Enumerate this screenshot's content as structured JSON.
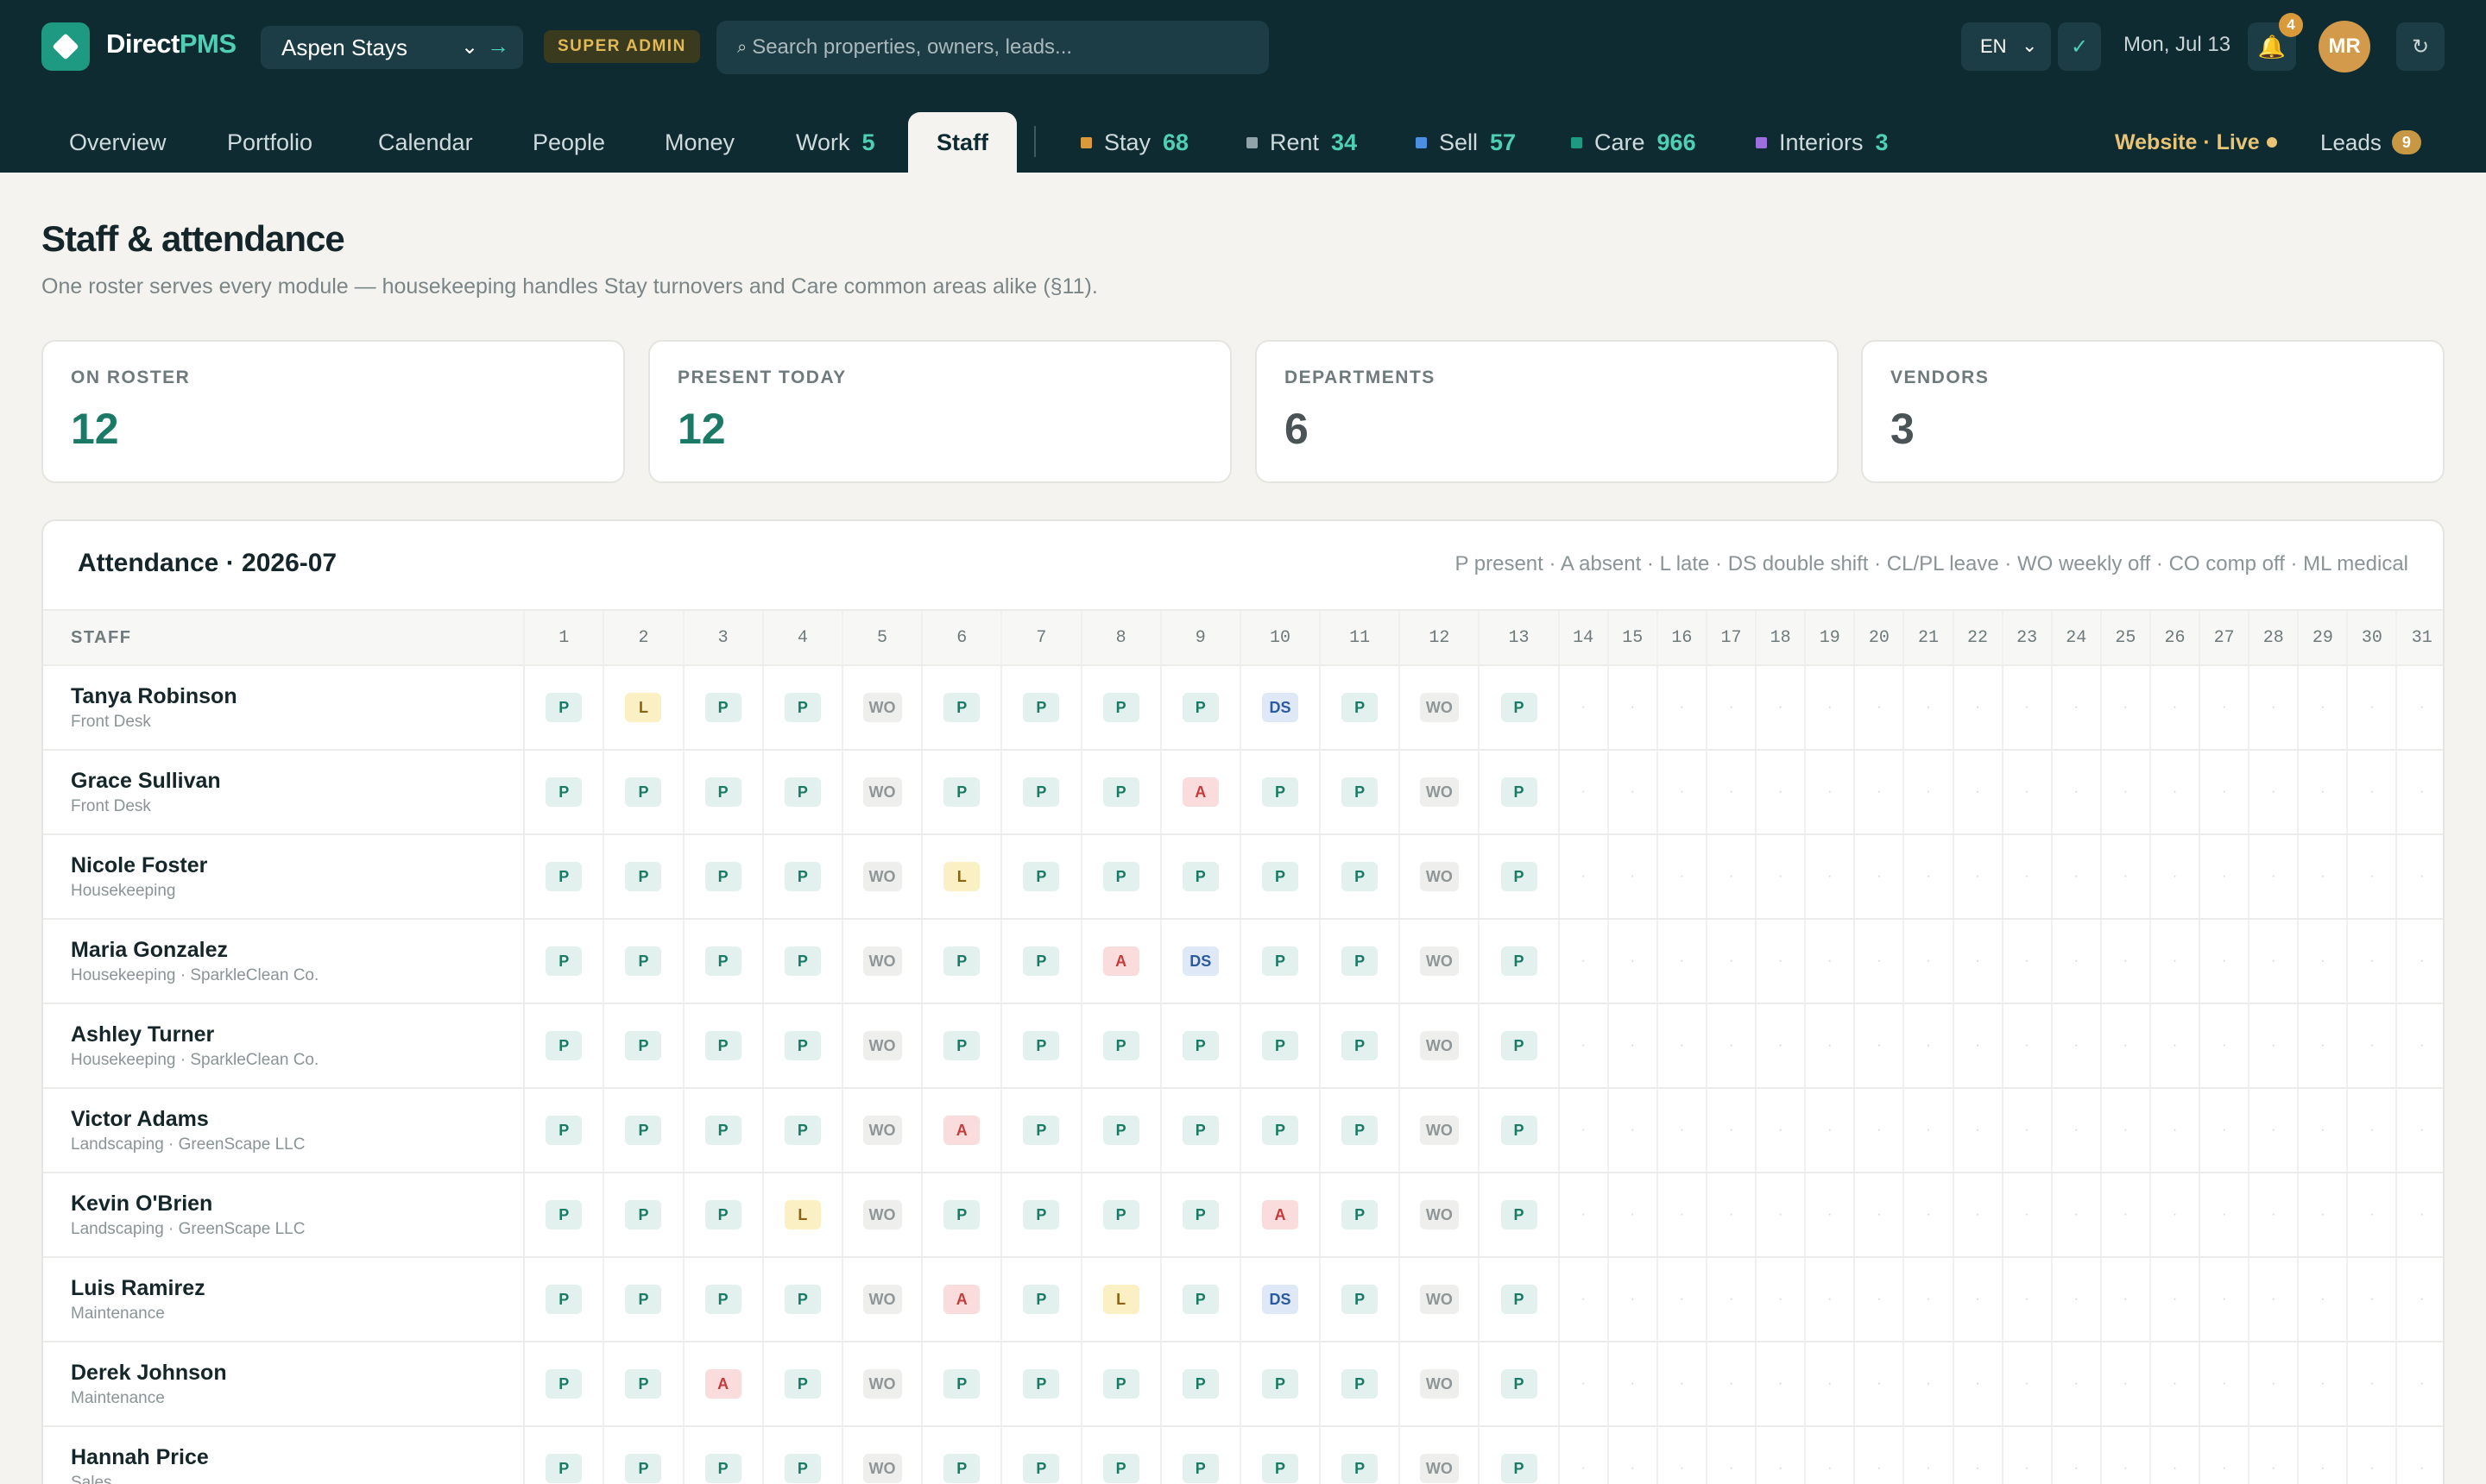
{
  "app": {
    "brand_main": "Direct",
    "brand_accent": "PMS",
    "property": "Aspen Stays",
    "role": "SUPER ADMIN",
    "search_placeholder": "Search properties, owners, leads...",
    "language": "EN",
    "date": "Mon, Jul 13",
    "notifications": "4",
    "user_initials": "MR"
  },
  "nav": {
    "tabs": [
      {
        "label": "Overview"
      },
      {
        "label": "Portfolio"
      },
      {
        "label": "Calendar"
      },
      {
        "label": "People"
      },
      {
        "label": "Money"
      },
      {
        "label": "Work",
        "count": "5"
      },
      {
        "label": "Staff",
        "active": true
      }
    ],
    "modules": [
      {
        "label": "Stay",
        "count": "68",
        "color": "#d99a3c"
      },
      {
        "label": "Rent",
        "count": "34",
        "color": "#8fa3a8"
      },
      {
        "label": "Sell",
        "count": "57",
        "color": "#4c8ee0"
      },
      {
        "label": "Care",
        "count": "966",
        "color": "#1f9a82"
      },
      {
        "label": "Interiors",
        "count": "3",
        "color": "#9b6fe0"
      }
    ],
    "website_label": "Website · Live",
    "leads_label": "Leads",
    "leads_count": "9"
  },
  "page": {
    "title": "Staff & attendance",
    "subtitle": "One roster serves every module — housekeeping handles Stay turnovers and Care common areas alike (§11)."
  },
  "stats": [
    {
      "label": "ON ROSTER",
      "value": "12",
      "color": "#1b7a66"
    },
    {
      "label": "PRESENT TODAY",
      "value": "12",
      "color": "#1b7a66"
    },
    {
      "label": "DEPARTMENTS",
      "value": "6",
      "color": "#4a5456"
    },
    {
      "label": "VENDORS",
      "value": "3",
      "color": "#4a5456"
    }
  ],
  "attendance": {
    "title": "Attendance · 2026-07",
    "legend": "P present · A absent · L late · DS double shift · CL/PL leave · WO weekly off · CO comp off · ML medical",
    "staff_header": "STAFF",
    "days": [
      "1",
      "2",
      "3",
      "4",
      "5",
      "6",
      "7",
      "8",
      "9",
      "10",
      "11",
      "12",
      "13",
      "14",
      "15",
      "16",
      "17",
      "18",
      "19",
      "20",
      "21",
      "22",
      "23",
      "24",
      "25",
      "26",
      "27",
      "28",
      "29",
      "30",
      "31"
    ],
    "empty_mark": "·",
    "rows": [
      {
        "name": "Tanya Robinson",
        "dept": "Front Desk",
        "marks": [
          "P",
          "L",
          "P",
          "P",
          "WO",
          "P",
          "P",
          "P",
          "P",
          "DS",
          "P",
          "WO",
          "P"
        ]
      },
      {
        "name": "Grace Sullivan",
        "dept": "Front Desk",
        "marks": [
          "P",
          "P",
          "P",
          "P",
          "WO",
          "P",
          "P",
          "P",
          "A",
          "P",
          "P",
          "WO",
          "P"
        ]
      },
      {
        "name": "Nicole Foster",
        "dept": "Housekeeping",
        "marks": [
          "P",
          "P",
          "P",
          "P",
          "WO",
          "L",
          "P",
          "P",
          "P",
          "P",
          "P",
          "WO",
          "P"
        ]
      },
      {
        "name": "Maria Gonzalez",
        "dept": "Housekeeping · SparkleClean Co.",
        "marks": [
          "P",
          "P",
          "P",
          "P",
          "WO",
          "P",
          "P",
          "A",
          "DS",
          "P",
          "P",
          "WO",
          "P"
        ]
      },
      {
        "name": "Ashley Turner",
        "dept": "Housekeeping · SparkleClean Co.",
        "marks": [
          "P",
          "P",
          "P",
          "P",
          "WO",
          "P",
          "P",
          "P",
          "P",
          "P",
          "P",
          "WO",
          "P"
        ]
      },
      {
        "name": "Victor Adams",
        "dept": "Landscaping · GreenScape LLC",
        "marks": [
          "P",
          "P",
          "P",
          "P",
          "WO",
          "A",
          "P",
          "P",
          "P",
          "P",
          "P",
          "WO",
          "P"
        ]
      },
      {
        "name": "Kevin O'Brien",
        "dept": "Landscaping · GreenScape LLC",
        "marks": [
          "P",
          "P",
          "P",
          "L",
          "WO",
          "P",
          "P",
          "P",
          "P",
          "A",
          "P",
          "WO",
          "P"
        ]
      },
      {
        "name": "Luis Ramirez",
        "dept": "Maintenance",
        "marks": [
          "P",
          "P",
          "P",
          "P",
          "WO",
          "A",
          "P",
          "L",
          "P",
          "DS",
          "P",
          "WO",
          "P"
        ]
      },
      {
        "name": "Derek Johnson",
        "dept": "Maintenance",
        "marks": [
          "P",
          "P",
          "A",
          "P",
          "WO",
          "P",
          "P",
          "P",
          "P",
          "P",
          "P",
          "WO",
          "P"
        ]
      },
      {
        "name": "Hannah Price",
        "dept": "Sales",
        "marks": [
          "P",
          "P",
          "P",
          "P",
          "WO",
          "P",
          "P",
          "P",
          "P",
          "P",
          "P",
          "WO",
          "P"
        ]
      }
    ]
  }
}
